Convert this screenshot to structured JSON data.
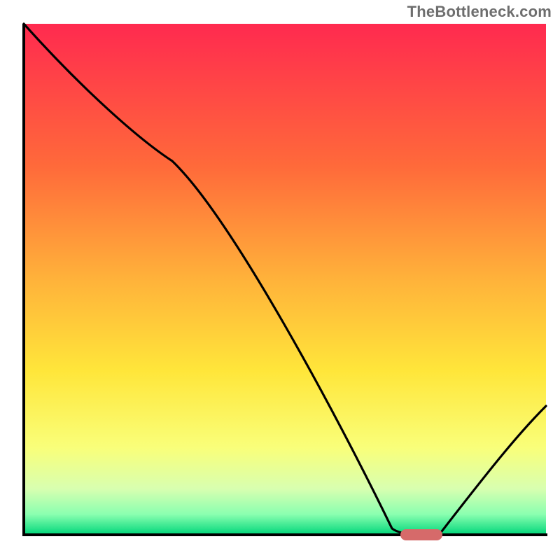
{
  "attribution": "TheBottleneck.com",
  "chart_data": {
    "type": "line",
    "title": "",
    "xlabel": "",
    "ylabel": "",
    "xlim": [
      0,
      100
    ],
    "ylim": [
      0,
      100
    ],
    "series": [
      {
        "name": "bottleneck-curve",
        "x": [
          0,
          28,
          72,
          78,
          100
        ],
        "y": [
          100,
          74,
          0,
          0,
          25
        ]
      }
    ],
    "markers": [
      {
        "name": "optimum-marker",
        "x": 75,
        "y": 0,
        "color": "#d66a6a"
      }
    ],
    "background_gradient": {
      "top": "#ff2a4f",
      "mid_upper": "#ffa23a",
      "mid": "#ffe63a",
      "mid_lower": "#f7ff9a",
      "low": "#8affb0",
      "bottom": "#00d67a"
    },
    "axis_color": "#000000"
  }
}
